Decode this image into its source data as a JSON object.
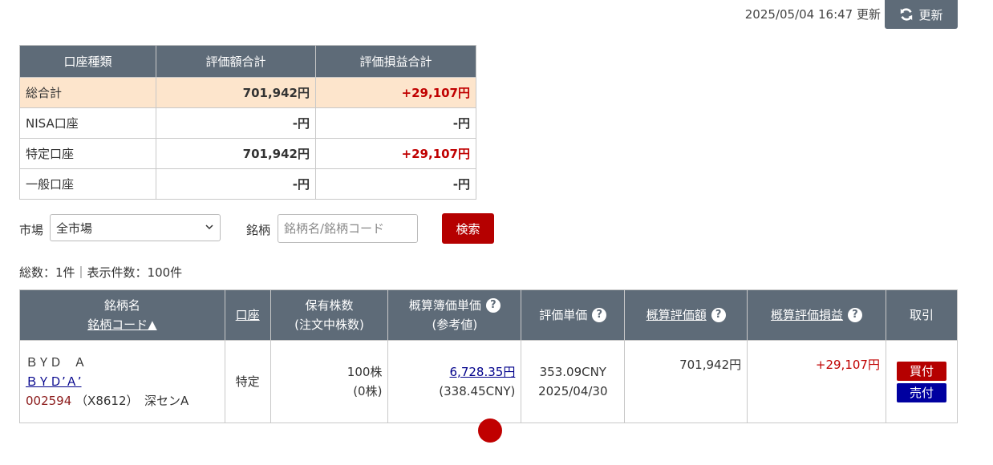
{
  "header": {
    "timestamp": "2025/05/04 16:47 更新",
    "refresh_label": "更新",
    "refresh_icon": "refresh-icon"
  },
  "summary": {
    "headers": [
      "口座種類",
      "評価額合計",
      "評価損益合計"
    ],
    "rows": [
      {
        "type": "総合計",
        "value": "701,942円",
        "pl": "+29,107円"
      },
      {
        "type": "NISA口座",
        "value": "-円",
        "pl": "-円"
      },
      {
        "type": "特定口座",
        "value": "701,942円",
        "pl": "+29,107円"
      },
      {
        "type": "一般口座",
        "value": "-円",
        "pl": "-円"
      }
    ]
  },
  "search": {
    "market_label": "市場",
    "market_value": "全市場",
    "stock_label": "銘柄",
    "stock_placeholder": "銘柄名/銘柄コード",
    "search_button": "検索"
  },
  "counts": "総数：1件｜表示件数：100件",
  "holdings": {
    "headers": {
      "name_line1": "銘柄名",
      "name_line2": "銘柄コード▲",
      "account": "口座",
      "shares_line1": "保有株数",
      "shares_line2": "(注文中株数)",
      "book_line1": "概算簿価単価",
      "book_line2": "(参考値)",
      "unit_price": "評価単価",
      "value": "概算評価額",
      "pl": "概算評価損益",
      "trade": "取引"
    },
    "help_icon": "?",
    "rows": [
      {
        "name": "ＢＹＤ　Ａ",
        "name_link": "ＢＹＤ’Ａ’",
        "code": "002594",
        "code_extra": "（X8612）　深センA",
        "account": "特定",
        "shares": "100株",
        "pending": "(0株)",
        "book_price": "6,728.35円",
        "book_price_cny": "(338.45CNY)",
        "unit_price": "353.09CNY",
        "unit_date": "2025/04/30",
        "value": "701,942円",
        "pl": "+29,107円",
        "buy": "買付",
        "sell": "売付"
      }
    ]
  },
  "colors": {
    "header_bg": "#5e6b78",
    "total_row_bg": "#fde5cc",
    "profit": "#c00000",
    "buy": "#b50000",
    "sell": "#0000a0"
  }
}
